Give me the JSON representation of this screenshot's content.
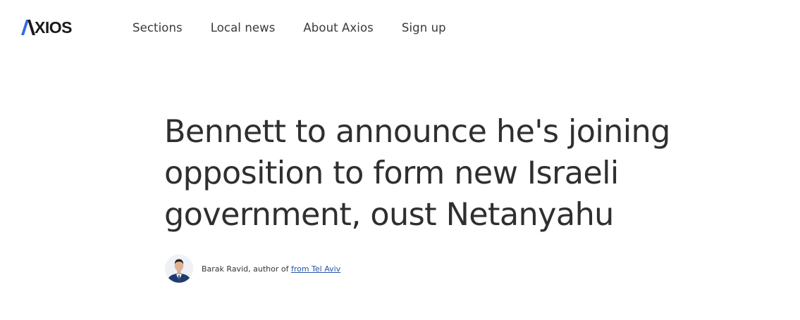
{
  "brand": {
    "logo_first_letter": "A",
    "logo_rest": "XIOS",
    "accent_color": "#2f6de1",
    "text_color": "#1a1a1a"
  },
  "nav": {
    "items": [
      {
        "label": "Sections"
      },
      {
        "label": "Local news"
      },
      {
        "label": "About Axios"
      },
      {
        "label": "Sign up"
      }
    ]
  },
  "article": {
    "headline": "Bennett to announce he's joining opposition to form new Israeli government, oust Netanyahu",
    "byline": {
      "author_prefix": "Barak Ravid, author of ",
      "location_link": "from Tel Aviv"
    }
  },
  "icons": {
    "author_avatar": "author-avatar-icon"
  }
}
